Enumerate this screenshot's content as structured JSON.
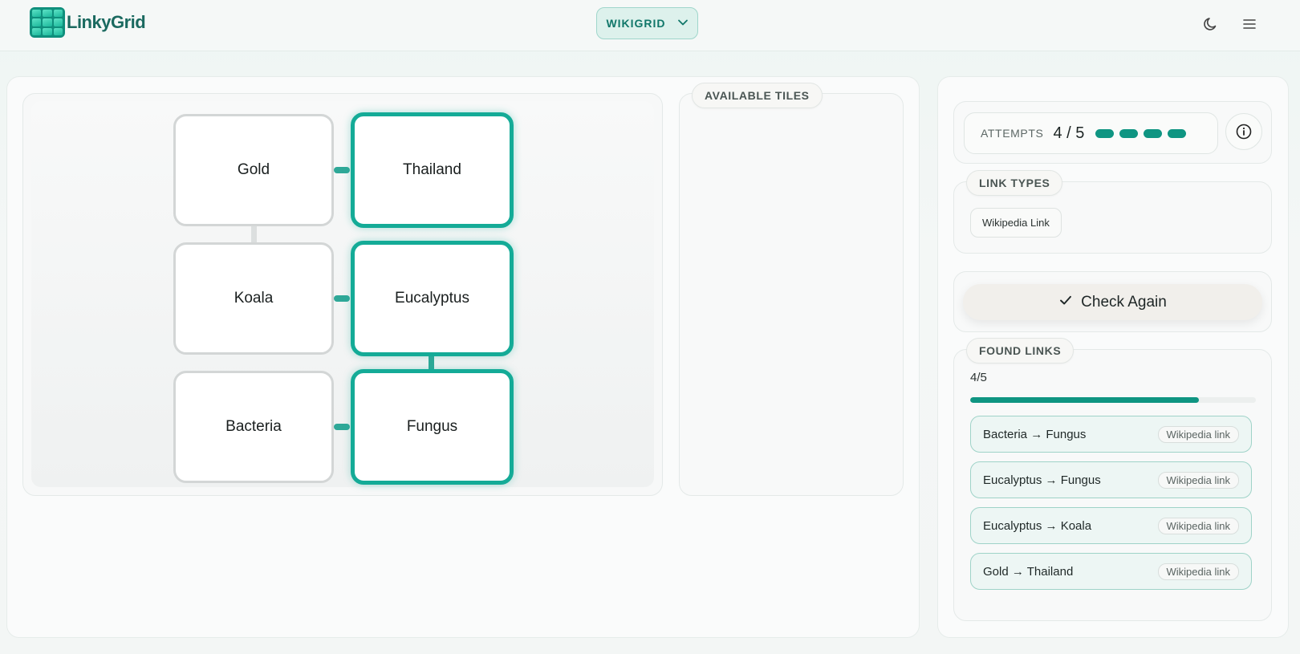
{
  "app": {
    "name": "LinkyGrid"
  },
  "header": {
    "mode": "WIKIGRID"
  },
  "grid": {
    "tiles": [
      {
        "label": "Gold",
        "linked": false
      },
      {
        "label": "Thailand",
        "linked": true
      },
      {
        "label": "Koala",
        "linked": false
      },
      {
        "label": "Eucalyptus",
        "linked": true
      },
      {
        "label": "Bacteria",
        "linked": false
      },
      {
        "label": "Fungus",
        "linked": true
      }
    ]
  },
  "tiles_panel": {
    "title": "AVAILABLE TILES"
  },
  "attempts": {
    "label": "ATTEMPTS",
    "value": "4 / 5",
    "remaining": 4
  },
  "link_types": {
    "title": "LINK TYPES",
    "items": [
      "Wikipedia Link"
    ]
  },
  "check_button": {
    "label": "Check Again"
  },
  "found_links": {
    "title": "FOUND LINKS",
    "count": "4/5",
    "progress": 0.8,
    "items": [
      {
        "text": "Bacteria → Fungus",
        "tag": "Wikipedia link"
      },
      {
        "text": "Eucalyptus → Fungus",
        "tag": "Wikipedia link"
      },
      {
        "text": "Eucalyptus → Koala",
        "tag": "Wikipedia link"
      },
      {
        "text": "Gold → Thailand",
        "tag": "Wikipedia link"
      }
    ]
  },
  "colors": {
    "accent": "#14ab97",
    "accent_dark": "#0f9582",
    "brand_text": "#1b6a60"
  },
  "icons": {
    "mode_chevron": "chevron-down-icon",
    "theme": "moon-icon",
    "menu": "hamburger-menu-icon",
    "info": "info-icon",
    "check": "checkmark-icon"
  }
}
